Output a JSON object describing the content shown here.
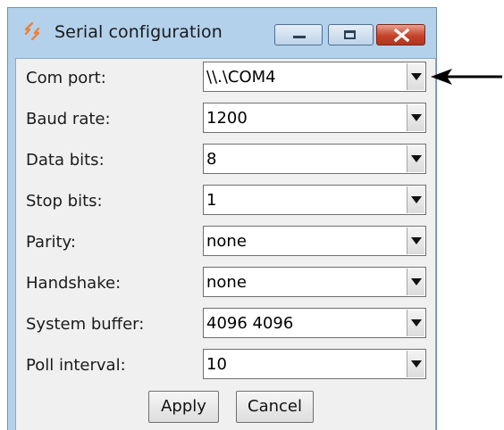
{
  "window": {
    "title": "Serial configuration"
  },
  "form": {
    "fields": [
      {
        "label": "Com port:",
        "value": "\\\\.\\COM4"
      },
      {
        "label": "Baud rate:",
        "value": "1200"
      },
      {
        "label": "Data bits:",
        "value": "8"
      },
      {
        "label": "Stop bits:",
        "value": "1"
      },
      {
        "label": "Parity:",
        "value": "none"
      },
      {
        "label": "Handshake:",
        "value": "none"
      },
      {
        "label": "System buffer:",
        "value": "4096 4096"
      },
      {
        "label": "Poll interval:",
        "value": "10"
      }
    ]
  },
  "buttons": {
    "apply": "Apply",
    "cancel": "Cancel"
  },
  "colors": {
    "frame": "#b4d1ec",
    "client": "#f0f0f0",
    "close_button": "#c4432a",
    "app_icon": "#e8833a"
  },
  "icons": {
    "app": "app-logo-icon",
    "minimize": "minimize-icon",
    "maximize": "maximize-icon",
    "close": "close-icon",
    "dropdown": "chevron-down-icon",
    "annotation": "arrow-left-icon"
  }
}
